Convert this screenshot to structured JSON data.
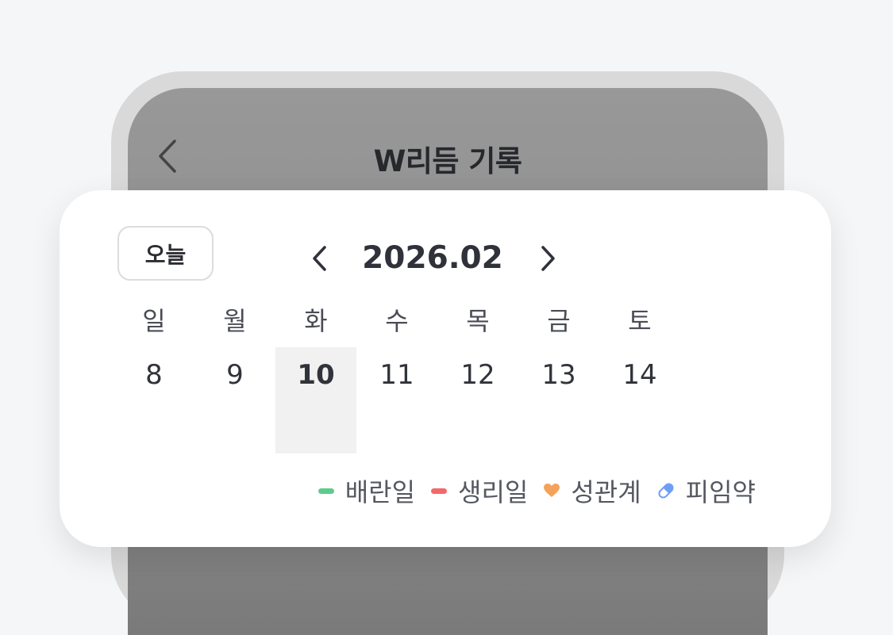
{
  "header": {
    "title": "W리듬 기록",
    "back_icon": "chevron-left-icon"
  },
  "calendar": {
    "today_label": "오늘",
    "month_label": "2026.02",
    "prev_icon": "chevron-left-icon",
    "next_icon": "chevron-right-icon",
    "weekdays": [
      "일",
      "월",
      "화",
      "수",
      "목",
      "금",
      "토"
    ],
    "dates": [
      "8",
      "9",
      "10",
      "11",
      "12",
      "13",
      "14"
    ],
    "selected_date": "10"
  },
  "legend": {
    "ovulation": {
      "label": "배란일",
      "color": "#5ecb8c",
      "icon": "green-dash-icon"
    },
    "period": {
      "label": "생리일",
      "color": "#f06a6a",
      "icon": "red-dash-icon"
    },
    "intercourse": {
      "label": "성관계",
      "color": "#f4a259",
      "icon": "heart-icon"
    },
    "pill": {
      "label": "피임약",
      "color": "#6f9ef5",
      "icon": "pill-icon"
    }
  }
}
